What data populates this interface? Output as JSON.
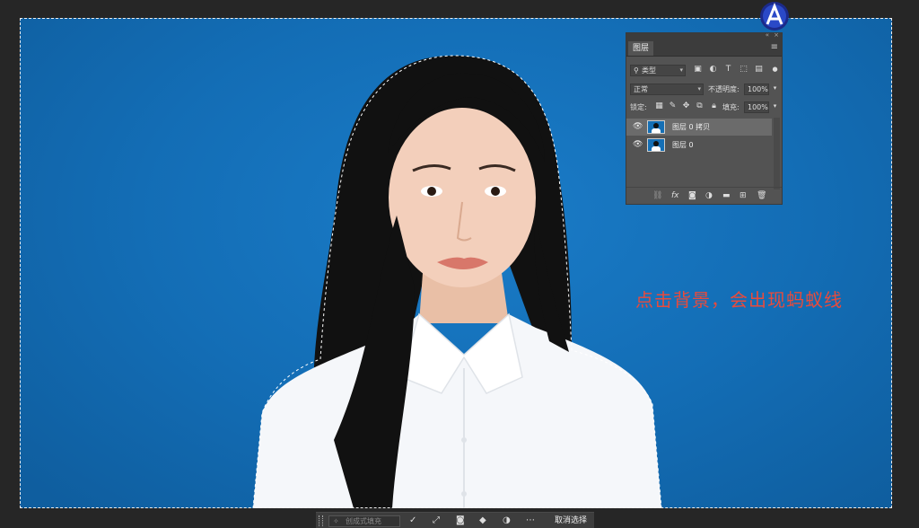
{
  "annotation": "点击背景，会出现蚂蚁线",
  "layers_panel": {
    "tab_label": "图层",
    "filter_label": "类型",
    "blend_mode": "正常",
    "opacity_label": "不透明度:",
    "opacity_value": "100%",
    "lock_label": "锁定:",
    "fill_label": "填充:",
    "fill_value": "100%",
    "layers": [
      {
        "name": "图层 0 拷贝",
        "selected": true,
        "visible": true
      },
      {
        "name": "图层 0",
        "selected": false,
        "visible": true
      }
    ],
    "bottom_icons": [
      "link-icon",
      "fx-icon",
      "mask-icon",
      "adjustment-icon",
      "folder-icon",
      "new-layer-icon",
      "trash-icon"
    ]
  },
  "context_bar": {
    "field_placeholder": "创成式填充",
    "deselect_label": "取消选择"
  },
  "colors": {
    "background_blue": "#136db5",
    "annotation_red": "#e84b3c",
    "panel_gray": "#535353"
  }
}
